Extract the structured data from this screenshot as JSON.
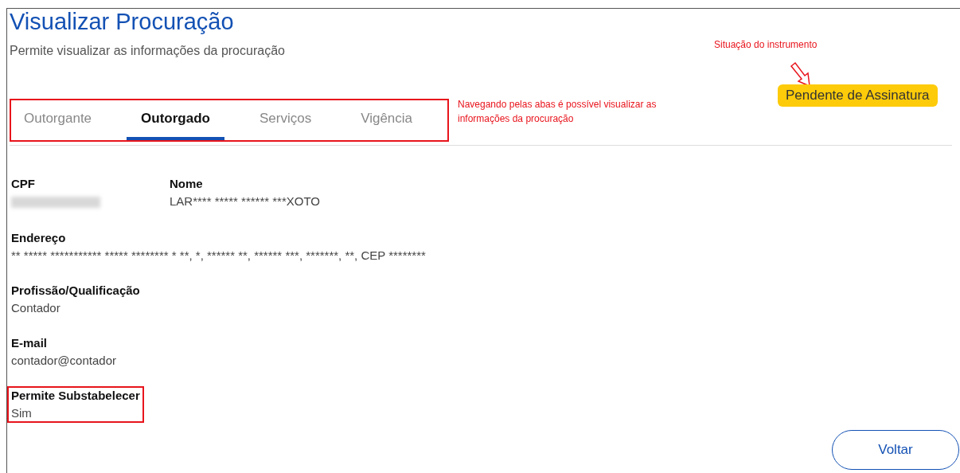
{
  "header": {
    "title": "Visualizar Procuração",
    "subtitle": "Permite visualizar as informações da procuração"
  },
  "status": {
    "annotation": "Situação do instrumento",
    "badge": "Pendente de Assinatura"
  },
  "tab_bar": {
    "highlighted": true,
    "annotation": "Navegando pelas abas é possível visualizar as informações da procuração",
    "tabs": [
      {
        "label": "Outorgante",
        "selected": false
      },
      {
        "label": "Outorgado",
        "selected": true
      },
      {
        "label": "Serviços",
        "selected": false
      },
      {
        "label": "Vigência",
        "selected": false
      }
    ]
  },
  "field_rows": [
    [
      {
        "label": "CPF",
        "kind": "blurred",
        "highlighted": false
      },
      {
        "label": "Nome",
        "kind": "text",
        "value": "LAR**** ***** ****** ***XOTO",
        "highlighted": false
      }
    ],
    [
      {
        "label": "Endereço",
        "kind": "text",
        "value": "** ***** *********** ***** ******** * **, *, ****** **, ****** ***, *******, **, CEP ********",
        "highlighted": false
      }
    ],
    [
      {
        "label": "Profissão/Qualificação",
        "kind": "text",
        "value": "Contador",
        "highlighted": false
      }
    ],
    [
      {
        "label": "E-mail",
        "kind": "text",
        "value": "contador@contador",
        "highlighted": false
      }
    ],
    [
      {
        "label": "Permite Substabelecer",
        "kind": "text",
        "value": "Sim",
        "highlighted": true
      }
    ]
  ],
  "buttons": [
    {
      "label": "Voltar"
    }
  ]
}
